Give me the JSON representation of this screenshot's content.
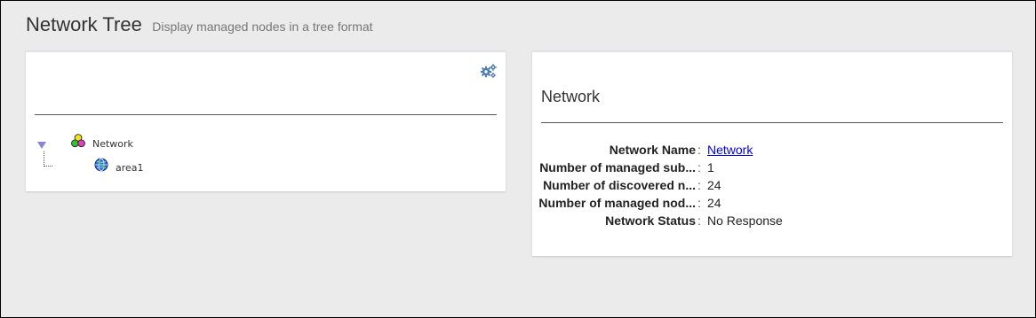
{
  "header": {
    "title": "Network Tree",
    "subtitle": "Display managed nodes in a tree format"
  },
  "tree": {
    "settings_icon": "gear-icon",
    "root": {
      "label": "Network",
      "icon": "network-group-icon",
      "expanded": true,
      "children": [
        {
          "label": "area1",
          "icon": "globe-icon"
        }
      ]
    }
  },
  "details": {
    "title": "Network",
    "rows": [
      {
        "key": "Network Name",
        "value": "Network",
        "is_link": true
      },
      {
        "key": "Number of managed sub...",
        "value": "1"
      },
      {
        "key": "Number of discovered n...",
        "value": "24"
      },
      {
        "key": "Number of managed nod...",
        "value": "24"
      },
      {
        "key": "Network Status",
        "value": "No Response"
      }
    ]
  },
  "colors": {
    "background": "#ebebeb",
    "panel": "#ffffff",
    "link": "#0000ee",
    "icon_blue": "#4a7fb5",
    "toggle": "#8a84d6"
  }
}
